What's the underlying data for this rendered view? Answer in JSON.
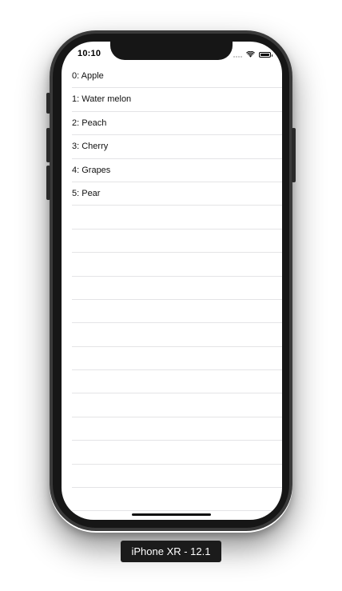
{
  "status_bar": {
    "time": "10:10",
    "wifi_icon": "wifi-icon",
    "battery_icon": "battery-icon",
    "signal_icon": "cellular-signal-icon"
  },
  "table": {
    "rows": [
      {
        "label": "0: Apple"
      },
      {
        "label": "1: Water melon"
      },
      {
        "label": "2: Peach"
      },
      {
        "label": "3: Cherry"
      },
      {
        "label": "4: Grapes"
      },
      {
        "label": "5: Pear"
      },
      {
        "label": ""
      },
      {
        "label": ""
      },
      {
        "label": ""
      },
      {
        "label": ""
      },
      {
        "label": ""
      },
      {
        "label": ""
      },
      {
        "label": ""
      },
      {
        "label": ""
      },
      {
        "label": ""
      },
      {
        "label": ""
      },
      {
        "label": ""
      },
      {
        "label": ""
      },
      {
        "label": ""
      },
      {
        "label": ""
      }
    ]
  },
  "simulator": {
    "device_label": "iPhone XR - 12.1"
  }
}
